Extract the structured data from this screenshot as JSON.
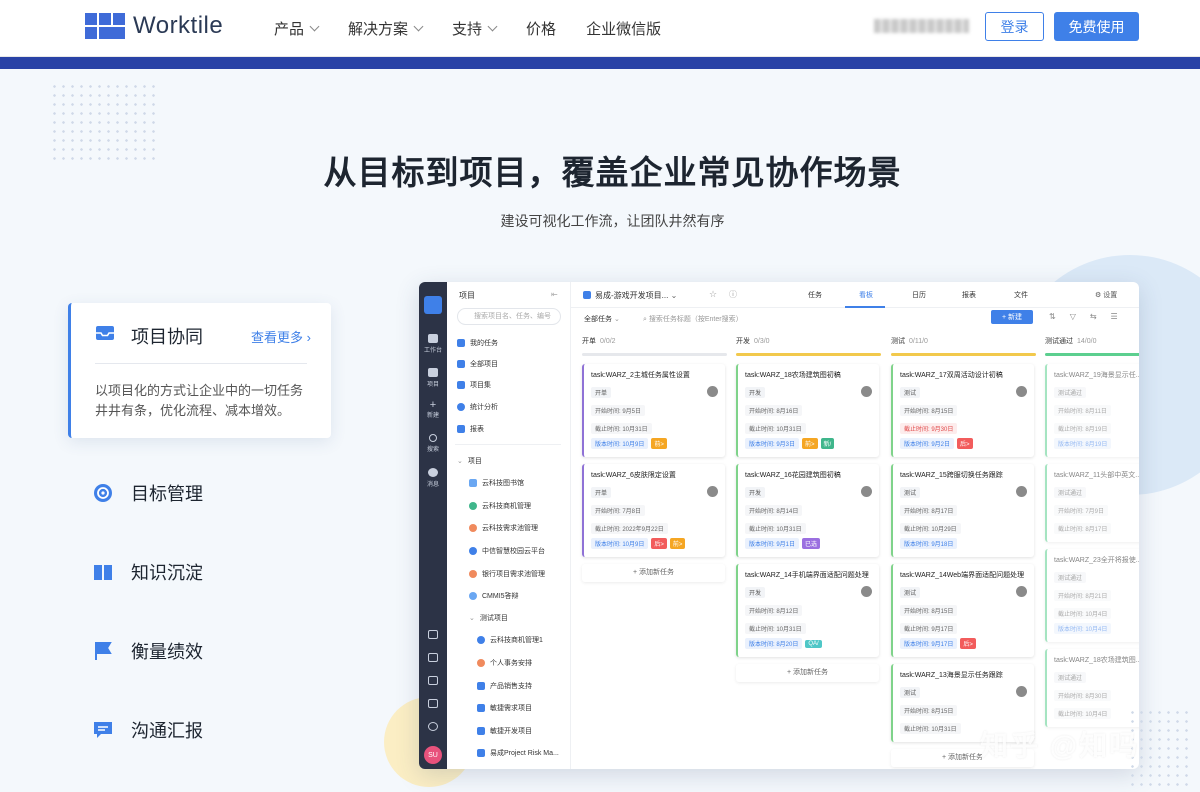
{
  "nav": {
    "logo_text": "Worktile",
    "menu": [
      "产品",
      "解决方案",
      "支持",
      "价格",
      "企业微信版"
    ],
    "login_label": "登录",
    "free_label": "免费使用"
  },
  "hero": {
    "title": "从目标到项目，覆盖企业常见协作场景",
    "subtitle": "建设可视化工作流，让团队井然有序"
  },
  "feature_card": {
    "title": "项目协同",
    "more": "查看更多",
    "desc": "以项目化的方式让企业中的一切任务井井有条，优化流程、减本增效。"
  },
  "features": [
    "目标管理",
    "知识沉淀",
    "衡量绩效",
    "沟通汇报"
  ],
  "app": {
    "rail": [
      "工作台",
      "项目",
      "新建",
      "搜索",
      "消息"
    ],
    "avatar": "SU",
    "side": {
      "title": "项目",
      "search_placeholder": "搜索项目名、任务、编号",
      "items": [
        "我的任务",
        "全部项目",
        "项目集",
        "统计分析",
        "报表"
      ],
      "group": "项目",
      "projects": [
        "云科技图书馆",
        "云科技商机管理",
        "云科技需求池管理",
        "中信智慧校园云平台",
        "银行项目需求池管理",
        "CMMI5答辩"
      ],
      "subgroup": "测试项目",
      "sub_projects": [
        "云科技商机管理1",
        "个人事务安排",
        "产品销售支持",
        "敏捷需求项目",
        "敏捷开发项目",
        "易成Project Risk Ma..."
      ]
    },
    "project_name": "易成-游戏开发项目...",
    "tabs": [
      "任务",
      "看板",
      "日历",
      "报表",
      "文件"
    ],
    "setting": "设置",
    "filter": "全部任务",
    "search": "搜索任务标题（按Enter搜索）",
    "new_btn": "+ 新建",
    "add_task": "添加新任务",
    "columns": [
      {
        "name": "开单",
        "count": "0/0/2",
        "color": "#e6e8ec",
        "tasks": [
          {
            "title": "task:WARZ_2主城任务属性设置",
            "state": "开单",
            "start": "开始时间: 9月5日",
            "end": "截止时间: 10月31日",
            "ver": "版本时间: 10月9日",
            "tags": [
              "前>"
            ]
          },
          {
            "title": "task:WARZ_6皮肤限定设置",
            "state": "开单",
            "start": "开始时间: 7月8日",
            "end": "截止时间: 2022年9月22日",
            "ver": "版本时间: 10月9日",
            "tags": [
              "后>",
              "前>"
            ]
          }
        ]
      },
      {
        "name": "开发",
        "count": "0/3/0",
        "color": "#f2c94c",
        "tasks": [
          {
            "title": "task:WARZ_18农场建筑图初稿",
            "state": "开发",
            "start": "开始时间: 8月16日",
            "end": "截止时间: 10月31日",
            "ver": "版本时间: 9月3日",
            "tags": [
              "前>",
              "新/"
            ]
          },
          {
            "title": "task:WARZ_16花园建筑图初稿",
            "state": "开发",
            "start": "开始时间: 8月14日",
            "end": "截止时间: 10月31日",
            "ver": "版本时间: 9月1日",
            "tags": [
              "已选"
            ]
          },
          {
            "title": "task:WARZ_14手机端界面适配问题处理",
            "state": "开发",
            "start": "开始时间: 8月12日",
            "end": "截止时间: 10月31日",
            "ver": "版本时间: 8月20日",
            "tags": [
              "QA/"
            ]
          }
        ]
      },
      {
        "name": "测试",
        "count": "0/11/0",
        "color": "#f2c94c",
        "tasks": [
          {
            "title": "task:WARZ_17双周活动设计初稿",
            "state": "测试",
            "start": "开始时间: 8月15日",
            "end": "截止时间: 9月30日",
            "ver": "版本时间: 9月2日",
            "tags": [
              "后>"
            ]
          },
          {
            "title": "task:WARZ_15跨服切换任务跟踪",
            "state": "测试",
            "start": "开始时间: 8月17日",
            "end": "截止时间: 10月29日",
            "ver": "版本时间: 9月18日",
            "tags": []
          },
          {
            "title": "task:WARZ_14Web端界面适配问题处理",
            "state": "测试",
            "start": "开始时间: 8月15日",
            "end": "截止时间: 9月17日",
            "ver": "版本时间: 9月17日",
            "tags": [
              "后>"
            ]
          },
          {
            "title": "task:WARZ_13海景显示任务跟踪",
            "state": "测试",
            "start": "开始时间: 8月15日",
            "end": "截止时间: 10月31日",
            "ver": "",
            "tags": []
          }
        ]
      },
      {
        "name": "测试通过",
        "count": "14/0/0",
        "color": "#5ccf8f",
        "tasks": [
          {
            "title": "task:WARZ_19海景显示任...",
            "state": "测试通过",
            "start": "开始时间: 8月11日",
            "end": "截止时间: 8月19日",
            "ver": "版本时间: 8月19日",
            "tags": []
          },
          {
            "title": "task:WARZ_11头部中英文...",
            "state": "测试通过",
            "start": "开始时间: 7月9日",
            "end": "截止时间: 8月17日",
            "ver": "",
            "tags": []
          },
          {
            "title": "task:WARZ_23全开将报使...",
            "state": "测试通过",
            "start": "开始时间: 8月21日",
            "end": "截止时间: 10月4日",
            "ver": "版本时间: 10月4日",
            "tags": []
          },
          {
            "title": "task:WARZ_18农场建筑图...",
            "state": "测试通过",
            "start": "开始时间: 8月30日",
            "end": "截止时间: 10月4日",
            "ver": "",
            "tags": []
          }
        ]
      }
    ]
  },
  "watermark": "知乎 @知吗"
}
